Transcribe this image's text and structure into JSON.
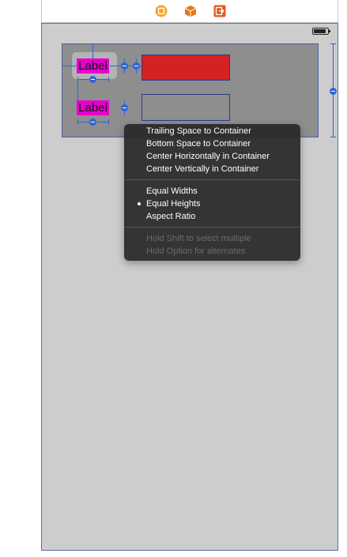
{
  "toolbar": {
    "icons": [
      "view-controller-icon",
      "first-responder-icon",
      "exit-icon"
    ],
    "colors": {
      "view_controller": "#f5a623",
      "first_responder": "#e8761a",
      "exit": "#e05a20"
    }
  },
  "canvas": {
    "labels": [
      "Label",
      "Label"
    ],
    "colors": {
      "label_bg": "#e600cc",
      "red_view": "#d42121",
      "constraint": "#2f64d6"
    }
  },
  "menu": {
    "items": [
      {
        "label": "Trailing Space to Container",
        "enabled": true
      },
      {
        "label": "Bottom Space to Container",
        "enabled": true
      },
      {
        "label": "Center Horizontally in Container",
        "enabled": true
      },
      {
        "label": "Center Vertically in Container",
        "enabled": true
      },
      {
        "label": "Equal Widths",
        "enabled": true
      },
      {
        "label": "Equal Heights",
        "enabled": true,
        "selected": true
      },
      {
        "label": "Aspect Ratio",
        "enabled": true
      }
    ],
    "hints": [
      "Hold Shift to select multiple",
      "Hold Option for alternates"
    ]
  }
}
